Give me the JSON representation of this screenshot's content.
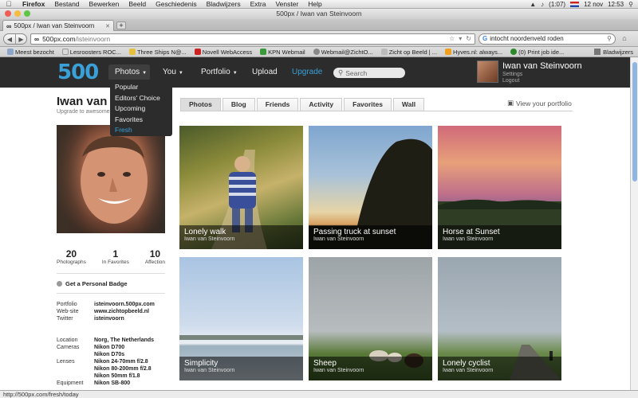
{
  "menubar": {
    "app": "Firefox",
    "items": [
      "Bestand",
      "Bewerken",
      "Beeld",
      "Geschiedenis",
      "Bladwijzers",
      "Extra",
      "Venster",
      "Help"
    ],
    "battery": "(1:07)",
    "date": "12 nov",
    "time": "12:53"
  },
  "window": {
    "title": "500px / Iwan van Steinvoorn"
  },
  "tab": {
    "label": "500px / Iwan van Steinvoorn"
  },
  "navbar": {
    "url_host": "500px.com",
    "url_path": "/isteinvoorn",
    "search_value": "intocht noordenveld roden"
  },
  "bookmarks": [
    "Meest bezocht",
    "Lesroosters ROC...",
    "Three Ships N@...",
    "Novell WebAccess",
    "KPN Webmail",
    "Webmail@ZichtO...",
    "Zicht op Beeld | ...",
    "Hyves.nl: always...",
    "(0) Print job ide..."
  ],
  "bookmarks_right": "Bladwijzers",
  "site": {
    "logo": "500",
    "nav": {
      "photos": "Photos",
      "you": "You",
      "portfolio": "Portfolio",
      "upload": "Upload",
      "upgrade": "Upgrade"
    },
    "search_placeholder": "Search",
    "user_name": "Iwan van Steinvoorn",
    "settings": "Settings",
    "logout": "Logout",
    "colors": {
      "accent": "#3aa0d8",
      "header": "#2c2c2c"
    }
  },
  "dropdown": [
    "Popular",
    "Editors' Choice",
    "Upcoming",
    "Favorites",
    "Fresh"
  ],
  "profile": {
    "name": "Iwan van Steinvoorn",
    "upgrade_text": "Upgrade to awesome",
    "stats": [
      {
        "value": "20",
        "label": "Photographs"
      },
      {
        "value": "1",
        "label": "In Favorites"
      },
      {
        "value": "10",
        "label": "Affection"
      }
    ],
    "badge": "Get a Personal Badge",
    "links": [
      {
        "key": "Portfolio",
        "value": "isteinvoorn.500px.com"
      },
      {
        "key": "Web-site",
        "value": "www.zichtopbeeld.nl"
      },
      {
        "key": "Twitter",
        "value": "isteinvoorn"
      }
    ],
    "details": [
      {
        "key": "Location",
        "value": "Norg, The Netherlands"
      },
      {
        "key": "Cameras",
        "value": "Nikon D700"
      },
      {
        "key": "",
        "value": "Nikon D70s"
      },
      {
        "key": "Lenses",
        "value": "Nikon 24-70mm f/2.8"
      },
      {
        "key": "",
        "value": "Nikon 80-200mm f/2.8"
      },
      {
        "key": "",
        "value": "Nikon 50mm f/1.8"
      },
      {
        "key": "Equipment",
        "value": "Nikon SB-800"
      }
    ]
  },
  "profile_tabs": [
    "Photos",
    "Blog",
    "Friends",
    "Activity",
    "Favorites",
    "Wall"
  ],
  "view_portfolio": "View your portfolio",
  "photos": [
    {
      "title": "Lonely walk",
      "author": "Iwan van Steinvoorn"
    },
    {
      "title": "Passing truck at sunset",
      "author": "Iwan van Steinvoorn"
    },
    {
      "title": "Horse at Sunset",
      "author": "Iwan van Steinvoorn"
    },
    {
      "title": "Simplicity",
      "author": "Iwan van Steinvoorn"
    },
    {
      "title": "Sheep",
      "author": "Iwan van Steinvoorn"
    },
    {
      "title": "Lonely cyclist",
      "author": "Iwan van Steinvoorn"
    }
  ],
  "status": "http://500px.com/fresh/today"
}
